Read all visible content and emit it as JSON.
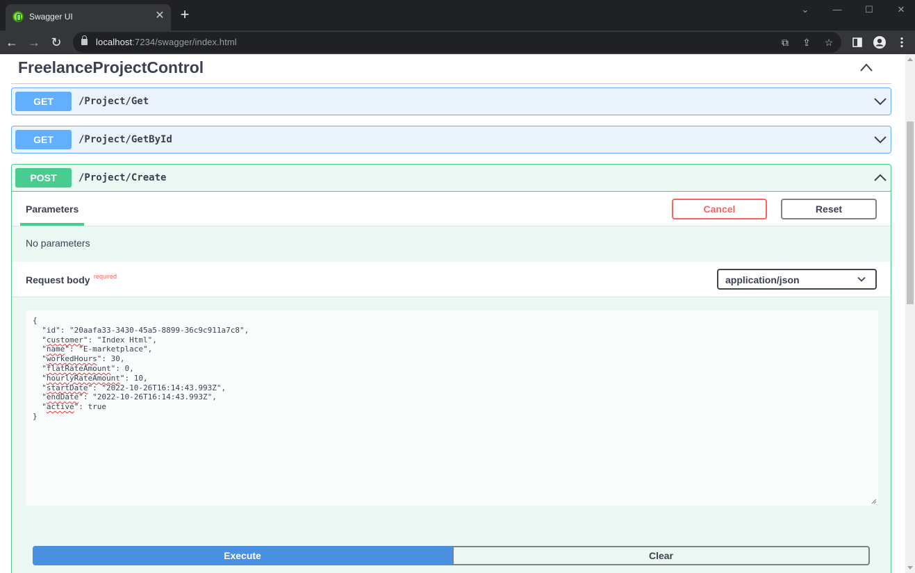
{
  "browser": {
    "tab_title": "Swagger UI",
    "tab_close": "✕",
    "new_tab": "+",
    "url_host": "localhost",
    "url_rest": ":7234/swagger/index.html",
    "window_controls": {
      "minimize": "—",
      "maximize": "☐",
      "close": "✕"
    },
    "nav": {
      "back": "←",
      "forward": "→",
      "reload": "↻"
    }
  },
  "section": {
    "title": "FreelanceProjectControl"
  },
  "operations": [
    {
      "method": "GET",
      "path": "/Project/Get"
    },
    {
      "method": "GET",
      "path": "/Project/GetById"
    },
    {
      "method": "POST",
      "path": "/Project/Create"
    }
  ],
  "post_panel": {
    "parameters_tab": "Parameters",
    "cancel_label": "Cancel",
    "reset_label": "Reset",
    "no_parameters": "No parameters",
    "request_body_title": "Request body",
    "required_label": "required",
    "content_type": "application/json",
    "execute_label": "Execute",
    "clear_label": "Clear"
  },
  "request_body": {
    "lines": [
      {
        "key": "",
        "value": "{"
      },
      {
        "key": "id",
        "value": "\"20aafa33-3430-45a5-8899-36c9c911a7c8\","
      },
      {
        "key": "customer",
        "value": "\"Index Html\","
      },
      {
        "key": "name",
        "value": "\"E-marketplace\","
      },
      {
        "key": "workedHours",
        "value": "30,"
      },
      {
        "key": "flatRateAmount",
        "value": "0,"
      },
      {
        "key": "hourlyRateAmount",
        "value": "10,"
      },
      {
        "key": "startDate",
        "value": "\"2022-10-26T16:14:43.993Z\","
      },
      {
        "key": "endDate",
        "value": "\"2022-10-26T16:14:43.993Z\","
      },
      {
        "key": "active",
        "value": "true"
      },
      {
        "key": "",
        "value": "}"
      }
    ]
  },
  "colors": {
    "get": "#61affe",
    "post": "#49cc90",
    "execute": "#4990e2",
    "cancel": "#ff6060"
  }
}
